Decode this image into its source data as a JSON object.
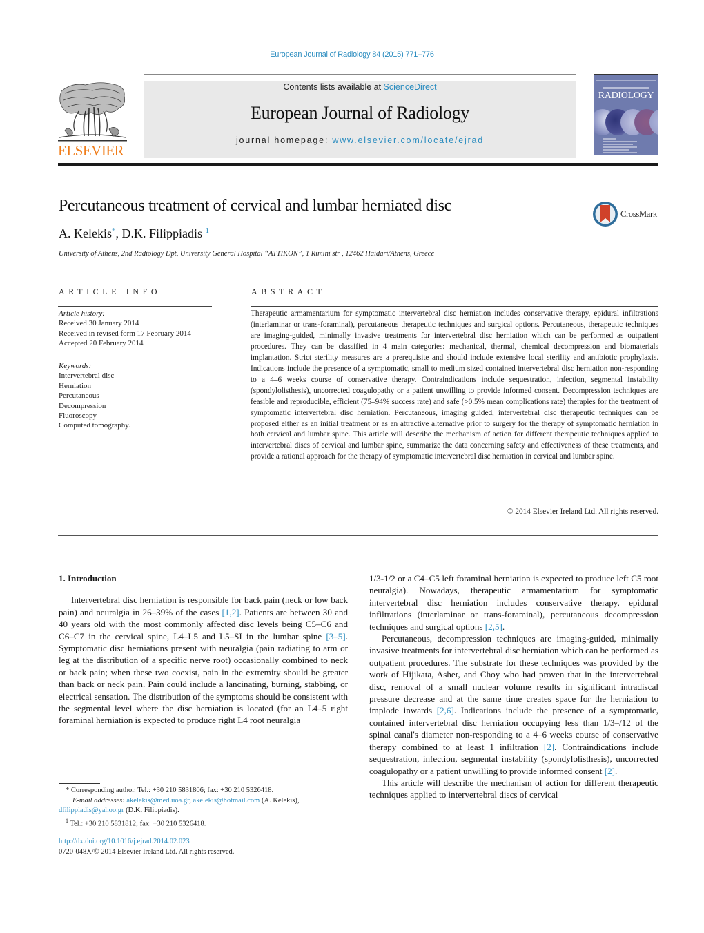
{
  "citation": "European Journal of Radiology 84 (2015) 771–776",
  "header": {
    "publisher_logo": "ELSEVIER",
    "contents_prefix": "Contents lists available at ",
    "contents_link": "ScienceDirect",
    "journal_name": "European Journal of Radiology",
    "homepage_prefix": "journal homepage: ",
    "homepage_link": "www.elsevier.com/locate/ejrad",
    "cover_title": "RADIOLOGY"
  },
  "colors": {
    "link": "#2a8cbf",
    "elsevier_orange": "#f07d1a",
    "cover_blue": "#6f7bae",
    "header_gray": "#e9e9e9"
  },
  "article": {
    "title": "Percutaneous treatment of cervical and lumbar herniated disc",
    "crossmark_label": "CrossMark",
    "authors": [
      {
        "name": "A. Kelekis",
        "mark": "*"
      },
      {
        "name": "D.K. Filippiadis",
        "mark": "1"
      }
    ],
    "author_separator": ", ",
    "affiliation": "University of Athens, 2nd Radiology Dpt, University General Hospital “ATTIKON”, 1 Rimini str , 12462 Haidari/Athens, Greece"
  },
  "article_info": {
    "heading": "ARTICLE INFO",
    "history_label": "Article history:",
    "history": [
      "Received 30 January 2014",
      "Received in revised form 17 February 2014",
      "Accepted 20 February 2014"
    ],
    "keywords_label": "Keywords:",
    "keywords": [
      "Intervertebral disc",
      "Herniation",
      "Percutaneous",
      "Decompression",
      "Fluoroscopy",
      "Computed tomography."
    ]
  },
  "abstract": {
    "heading": "ABSTRACT",
    "text": "Therapeutic armamentarium for symptomatic intervertebral disc herniation includes conservative therapy, epidural infiltrations (interlaminar or trans-foraminal), percutaneous therapeutic techniques and surgical options. Percutaneous, therapeutic techniques are imaging-guided, minimally invasive treatments for intervertebral disc herniation which can be performed as outpatient procedures. They can be classified in 4 main categories: mechanical, thermal, chemical decompression and biomaterials implantation. Strict sterility measures are a prerequisite and should include extensive local sterility and antibiotic prophylaxis. Indications include the presence of a symptomatic, small to medium sized contained intervertebral disc herniation non-responding to a 4–6 weeks course of conservative therapy. Contraindications include sequestration, infection, segmental instability (spondylolisthesis), uncorrected coagulopathy or a patient unwilling to provide informed consent. Decompression techniques are feasible and reproducible, efficient (75–94% success rate) and safe (>0.5% mean complications rate) therapies for the treatment of symptomatic intervertebral disc herniation. Percutaneous, imaging guided, intervertebral disc therapeutic techniques can be proposed either as an initial treatment or as an attractive alternative prior to surgery for the therapy of symptomatic herniation in both cervical and lumbar spine. This article will describe the mechanism of action for different therapeutic techniques applied to intervertebral discs of cervical and lumbar spine, summarize the data concerning safety and effectiveness of these treatments, and provide a rational approach for the therapy of symptomatic intervertebral disc herniation in cervical and lumbar spine.",
    "copyright": "© 2014 Elsevier Ireland Ltd. All rights reserved."
  },
  "body": {
    "section_heading": "1.  Introduction",
    "left_para1": [
      {
        "t": "Intervertebral disc herniation is responsible for back pain (neck or low back pain) and neuralgia in 26–39% of the cases "
      },
      {
        "c": "[1,2]"
      },
      {
        "t": ". Patients are between 30 and 40 years old with the most commonly affected disc levels being C5–C6 and C6–C7 in the cervical spine, L4–L5 and L5–SI in the lumbar spine "
      },
      {
        "c": "[3–5]"
      },
      {
        "t": ". Symptomatic disc herniations present with neuralgia (pain radiating to arm or leg at the distribution of a specific nerve root) occasionally combined to neck or back pain; when these two coexist, pain in the extremity should be greater than back or neck pain. Pain could include a lancinating, burning, stabbing, or electrical sensation. The distribution of the symptoms should be consistent with the segmental level where the disc herniation is located (for an L4–5 right foraminal herniation is expected to produce right L4 root neuralgia"
      }
    ],
    "right_para1": [
      {
        "t": "1/3-1/2 or a C4–C5 left foraminal herniation is expected to produce left C5 root neuralgia). Nowadays, therapeutic armamentarium for symptomatic intervertebral disc herniation includes conservative therapy, epidural infiltrations (interlaminar or trans-foraminal), percutaneous decompression techniques and surgical options "
      },
      {
        "c": "[2,5]"
      },
      {
        "t": "."
      }
    ],
    "right_para2": [
      {
        "t": "Percutaneous, decompression techniques are imaging-guided, minimally invasive treatments for intervertebral disc herniation which can be performed as outpatient procedures. The substrate for these techniques was provided by the work of Hijikata, Asher, and Choy who had proven that in the intervertebral disc, removal of a small nuclear volume results in significant intradiscal pressure decrease and at the same time creates space for the herniation to implode inwards "
      },
      {
        "c": "[2,6]"
      },
      {
        "t": ". Indications include the presence of a symptomatic, contained intervertebral disc herniation occupying less than 1/3–/12 of the spinal canal's diameter non-responding to a 4–6 weeks course of conservative therapy combined to at least 1 infiltration "
      },
      {
        "c": "[2]"
      },
      {
        "t": ". Contraindications include sequestration, infection, segmental instability (spondylolisthesis), uncorrected coagulopathy or a patient unwilling to provide informed consent "
      },
      {
        "c": "[2]"
      },
      {
        "t": "."
      }
    ],
    "right_para3": [
      {
        "t": "This article will describe the mechanism of action for different therapeutic techniques applied to intervertebral discs of cervical"
      }
    ]
  },
  "footnotes": {
    "corresponding_mark": "*",
    "corresponding": "Corresponding author. Tel.: +30 210 5831806; fax: +30 210 5326418.",
    "email_label": "E-mail addresses:",
    "email1": "akelekis@med.uoa.gr",
    "email2": "akelekis@hotmail.com",
    "email2_owner": " (A. Kelekis),",
    "email3": "dfilippiadis@yahoo.gr",
    "email3_owner": " (D.K. Filippiadis).",
    "note1_mark": "1",
    "note1": "Tel.: +30 210 5831812; fax: +30 210 5326418."
  },
  "doi": {
    "link": "http://dx.doi.org/10.1016/j.ejrad.2014.02.023",
    "issn_line": "0720-048X/© 2014 Elsevier Ireland Ltd. All rights reserved."
  }
}
